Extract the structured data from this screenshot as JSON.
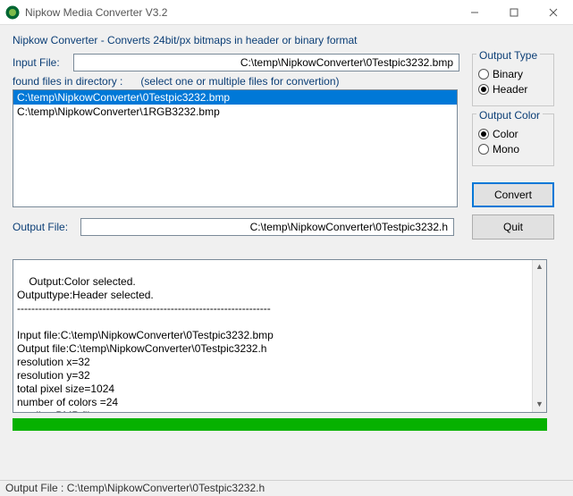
{
  "window": {
    "title": "Nipkow Media Converter V3.2"
  },
  "description": "Nipkow Converter - Converts 24bit/px bitmaps in header or binary format",
  "input": {
    "label": "Input File:",
    "value": "C:\\temp\\NipkowConverter\\0Testpic3232.bmp"
  },
  "found": {
    "label": "found files in directory :",
    "hint": "(select one or multiple files for convertion)"
  },
  "files": [
    {
      "path": "C:\\temp\\NipkowConverter\\0Testpic3232.bmp",
      "selected": true
    },
    {
      "path": "C:\\temp\\NipkowConverter\\1RGB3232.bmp",
      "selected": false
    }
  ],
  "output": {
    "label": "Output File:",
    "value": "C:\\temp\\NipkowConverter\\0Testpic3232.h"
  },
  "output_type": {
    "title": "Output Type",
    "options": {
      "binary": "Binary",
      "header": "Header"
    },
    "selected": "header"
  },
  "output_color": {
    "title": "Output Color",
    "options": {
      "color": "Color",
      "mono": "Mono"
    },
    "selected": "color"
  },
  "buttons": {
    "convert": "Convert",
    "quit": "Quit"
  },
  "log": "Output:Color selected.\nOutputtype:Header selected.\n-----------------------------------------------------------------------\n\nInput file:C:\\temp\\NipkowConverter\\0Testpic3232.bmp\nOutput file:C:\\temp\\NipkowConverter\\0Testpic3232.h\nresolution x=32\nresolution y=32\ntotal pixel size=1024\nnumber of colors =24\nreading BMP file...\nwriting output file...\nOK - Conversion finished\nFiles closed",
  "status": "Output File : C:\\temp\\NipkowConverter\\0Testpic3232.h"
}
